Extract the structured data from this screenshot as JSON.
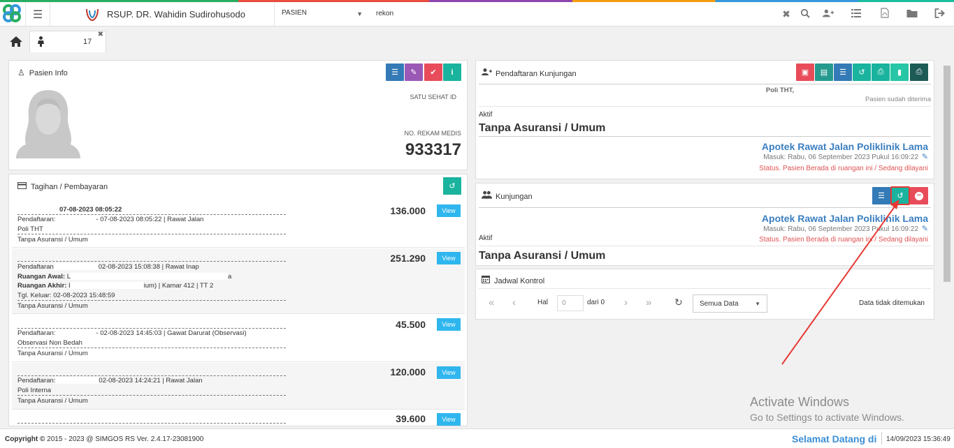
{
  "topbar": {
    "hospital_name": "RSUP. DR. Wahidin Sudirohusodo",
    "category": "PASIEN",
    "search_value": "rekon"
  },
  "tabs": {
    "patient_tab_suffix": "17"
  },
  "pasien_info": {
    "title": "Pasien Info",
    "satu_sehat_label": "SATU SEHAT ID",
    "rm_label": "NO. REKAM MEDIS",
    "rm_value": "933317"
  },
  "tagihan": {
    "title": "Tagihan / Pembayaran",
    "view_label": "View",
    "items": [
      {
        "line1": "07-08-2023 08:05:22",
        "reg_label": "Pendaftaran:",
        "reg_text": "- 07-08-2023 08:05:22 | Rawat Jalan",
        "unit": "Poli THT",
        "payer": "Tanpa Asuransi / Umum",
        "amount": "136.000"
      },
      {
        "reg_label": "Pendaftaran",
        "reg_text": "02-08-2023 15:08:38 | Rawat Inap",
        "room_awal_label": "Ruangan Awal:",
        "room_awal_value": "L",
        "room_awal_tail": "a",
        "room_akhir_label": "Ruangan Akhir:",
        "room_akhir_value": "I",
        "room_akhir_tail": "ium) | Kamar 412 | TT 2",
        "keluar": "Tgl. Keluar: 02-08-2023 15:48:59",
        "payer": "Tanpa Asuransi / Umum",
        "amount": "251.290"
      },
      {
        "reg_label": "Pendaftaran:",
        "reg_text": "- 02-08-2023 14:45:03 | Gawat Darurat (Observasi)",
        "unit": "Observasi Non Bedah",
        "payer": "Tanpa Asuransi / Umum",
        "amount": "45.500"
      },
      {
        "reg_label": "Pendaftaran:",
        "reg_text": "02-08-2023 14:24:21 | Rawat Jalan",
        "unit": "Poli Interna",
        "payer": "Tanpa Asuransi / Umum",
        "amount": "120.000"
      },
      {
        "amount": "39.600"
      }
    ]
  },
  "pendaftaran": {
    "title": "Pendaftaran Kunjungan",
    "poli": "Poli THT,",
    "diterima": "Pasien sudah diterima",
    "aktif": "Aktif",
    "asuransi": "Tanpa Asuransi / Umum",
    "apotek": "Apotek Rawat Jalan Poliklinik Lama",
    "masuk": "Masuk: Rabu, 06 September 2023 Pukul 16:09:22",
    "status": "Status. Pasien Berada di ruangan ini / Sedang dilayani"
  },
  "kunjungan": {
    "title": "Kunjungan",
    "apotek": "Apotek Rawat Jalan Poliklinik Lama",
    "masuk": "Masuk: Rabu, 06 September 2023 Pukul 16:09:22",
    "status": "Status. Pasien Berada di ruangan ini / Sedang dilayani",
    "aktif": "Aktif",
    "asuransi": "Tanpa Asuransi / Umum"
  },
  "jadwal": {
    "title": "Jadwal Kontrol",
    "hal_label": "Hal",
    "page_value": "0",
    "dari_label": "dari 0",
    "filter": "Semua Data",
    "empty": "Data tidak ditemukan"
  },
  "watermark": {
    "line1": "Activate Windows",
    "line2": "Go to Settings to activate Windows."
  },
  "footer": {
    "copyright_label": "Copyright",
    "copyright_text": "2015 - 2023 @ SIMGOS RS Ver. 2.4.17-23081900",
    "welcome": "Selamat Datang di",
    "datetime": "14/09/2023 15:36:49"
  },
  "colors": {
    "accent_blue": "#337ab7",
    "accent_teal": "#1ab39e",
    "accent_red": "#e84c5a",
    "link_blue": "#3a7fc1",
    "annotation_red": "#e53935"
  }
}
